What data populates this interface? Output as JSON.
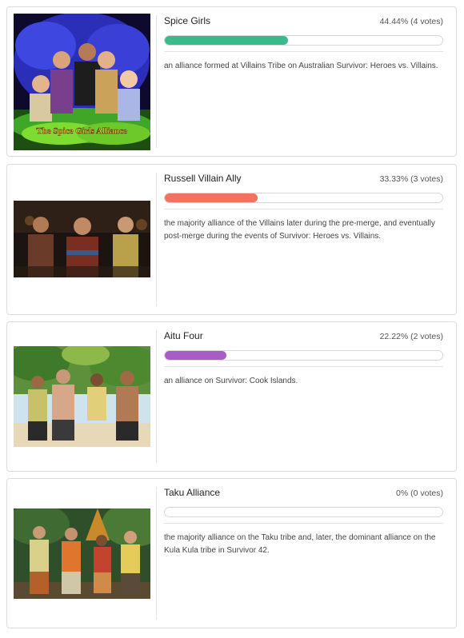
{
  "options": [
    {
      "name": "Spice Girls",
      "percent": "44.44%",
      "votes": "(4 votes)",
      "fraction": 0.4444,
      "color": "#3aba8a",
      "description": "an alliance formed at Villains Tribe on Australian Survivor: Heroes vs. Villains.",
      "image_caption": "The Spice Girls Alliance"
    },
    {
      "name": "Russell Villain Ally",
      "percent": "33.33%",
      "votes": "(3 votes)",
      "fraction": 0.3333,
      "color": "#f5715f",
      "description": "the majority alliance of the Villains later during the pre-merge, and eventually post-merge during the events of Survivor: Heroes vs. Villains."
    },
    {
      "name": "Aitu Four",
      "percent": "22.22%",
      "votes": "(2 votes)",
      "fraction": 0.2222,
      "color": "#a85cc8",
      "description": "an alliance on Survivor: Cook Islands."
    },
    {
      "name": "Taku Alliance",
      "percent": "0%",
      "votes": "(0 votes)",
      "fraction": 0,
      "color": "#cccccc",
      "description": "the majority alliance on the Taku tribe and, later, the dominant alliance on the Kula Kula tribe in Survivor 42."
    }
  ]
}
